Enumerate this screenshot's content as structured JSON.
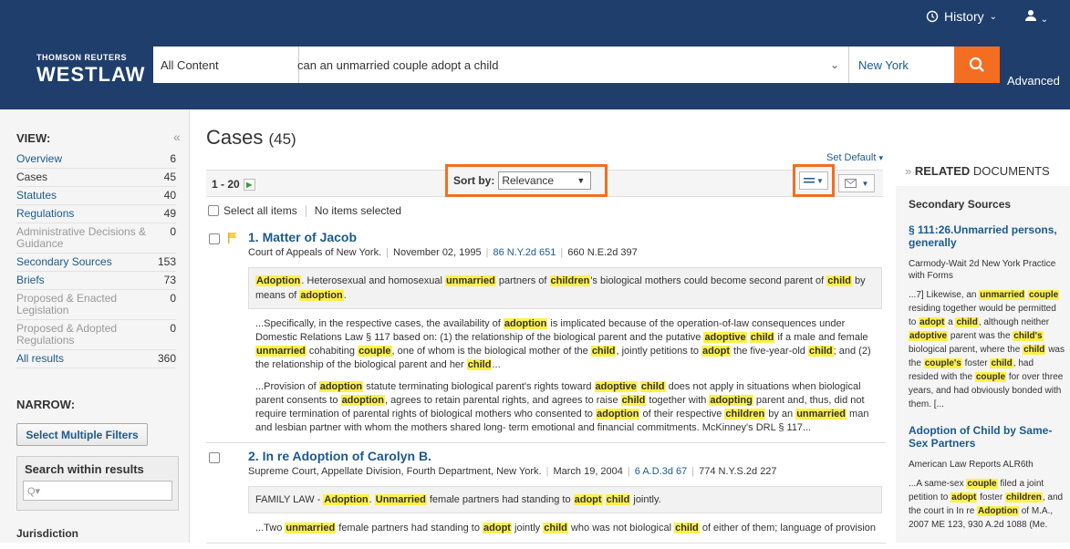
{
  "topbar": {
    "history": "History",
    "user_chevron": "⌄"
  },
  "logo": {
    "line1": "THOMSON REUTERS",
    "line2": "WESTLAW"
  },
  "search": {
    "scope": "All Content",
    "query": "can an unmarried couple adopt a child",
    "jurisdiction": "New York",
    "advanced": "Advanced"
  },
  "sidebar": {
    "view_label": "VIEW:",
    "items": [
      {
        "label": "Overview",
        "count": "6",
        "state": "link"
      },
      {
        "label": "Cases",
        "count": "45",
        "state": "active"
      },
      {
        "label": "Statutes",
        "count": "40",
        "state": "link"
      },
      {
        "label": "Regulations",
        "count": "49",
        "state": "link"
      },
      {
        "label": "Administrative Decisions & Guidance",
        "count": "0",
        "state": "disabled"
      },
      {
        "label": "Secondary Sources",
        "count": "153",
        "state": "link"
      },
      {
        "label": "Briefs",
        "count": "73",
        "state": "link"
      },
      {
        "label": "Proposed & Enacted Legislation",
        "count": "0",
        "state": "disabled"
      },
      {
        "label": "Proposed & Adopted Regulations",
        "count": "0",
        "state": "disabled"
      },
      {
        "label": "All results",
        "count": "360",
        "state": "link"
      }
    ],
    "narrow_label": "NARROW:",
    "filter_button": "Select Multiple Filters",
    "search_within": "Search within results",
    "search_within_placeholder": "Q▾",
    "jurisdiction_label": "Jurisdiction"
  },
  "main": {
    "title": "Cases",
    "count": "(45)",
    "set_default": "Set Default",
    "pager": "1 - 20",
    "sort_label": "Sort by:",
    "sort_value": "Relevance",
    "select_all": "Select all items",
    "no_selected": "No items selected",
    "results": [
      {
        "num": "1.",
        "title": "Matter of Jacob",
        "court": "Court of Appeals of New York.",
        "date": "November 02, 1995",
        "cite1": "86 N.Y.2d 651",
        "cite2": "660 N.E.2d 397",
        "headnote": [
          [
            "Adoption",
            1
          ],
          [
            ". Heterosexual and homosexual ",
            0
          ],
          [
            "unmarried",
            1
          ],
          [
            " partners of ",
            0
          ],
          [
            "children",
            1
          ],
          [
            "'s biological mothers could become second parent of ",
            0
          ],
          [
            "child",
            1
          ],
          [
            " by means of ",
            0
          ],
          [
            "adoption",
            1
          ],
          [
            ".",
            0
          ]
        ],
        "snippets": [
          [
            [
              "...Specifically, in the respective cases, the availability of ",
              0
            ],
            [
              "adoption",
              1
            ],
            [
              " is implicated because of the operation-of-law consequences under Domestic Relations Law §  117 based on:  (1) the relationship of the biological parent and the putative ",
              0
            ],
            [
              "adoptive",
              1
            ],
            [
              " ",
              0
            ],
            [
              "child",
              1
            ],
            [
              " if a male and female ",
              0
            ],
            [
              "unmarried",
              1
            ],
            [
              " cohabiting ",
              0
            ],
            [
              "couple",
              1
            ],
            [
              ", one of whom is the biological mother of the ",
              0
            ],
            [
              "child",
              1
            ],
            [
              ", jointly petitions to ",
              0
            ],
            [
              "adopt",
              1
            ],
            [
              " the five-year-old ",
              0
            ],
            [
              "child",
              1
            ],
            [
              ";  and (2) the relationship of the biological parent and her ",
              0
            ],
            [
              "child",
              1
            ],
            [
              "...",
              0
            ]
          ],
          [
            [
              "...Provision of ",
              0
            ],
            [
              "adoption",
              1
            ],
            [
              " statute terminating biological parent's rights toward ",
              0
            ],
            [
              "adoptive",
              1
            ],
            [
              " ",
              0
            ],
            [
              "child",
              1
            ],
            [
              " does not apply in situations when biological parent consents to ",
              0
            ],
            [
              "adoption",
              1
            ],
            [
              ", agrees to retain parental rights, and agrees to raise ",
              0
            ],
            [
              "child",
              1
            ],
            [
              " together with ",
              0
            ],
            [
              "adopting",
              1
            ],
            [
              " parent and, thus, did not require termination of parental rights of biological mothers who consented to ",
              0
            ],
            [
              "adoption",
              1
            ],
            [
              " of their respective ",
              0
            ],
            [
              "children",
              1
            ],
            [
              " by an ",
              0
            ],
            [
              "unmarried",
              1
            ],
            [
              " man and lesbian partner with whom the mothers shared long- term emotional and financial commitments.   McKinney's DRL §  117...",
              0
            ]
          ]
        ]
      },
      {
        "num": "2.",
        "title": "In re Adoption of Carolyn B.",
        "court": "Supreme Court, Appellate Division, Fourth Department, New York.",
        "date": "March 19, 2004",
        "cite1": "6 A.D.3d 67",
        "cite2": "774 N.Y.S.2d 227",
        "headnote": [
          [
            "FAMILY LAW - ",
            0
          ],
          [
            "Adoption",
            1
          ],
          [
            ". ",
            0
          ],
          [
            "Unmarried",
            1
          ],
          [
            " female partners had standing to ",
            0
          ],
          [
            "adopt",
            1
          ],
          [
            " ",
            0
          ],
          [
            "child",
            1
          ],
          [
            " jointly.",
            0
          ]
        ],
        "snippets": [
          [
            [
              "...Two ",
              0
            ],
            [
              "unmarried",
              1
            ],
            [
              " female partners had standing to ",
              0
            ],
            [
              "adopt",
              1
            ],
            [
              " jointly ",
              0
            ],
            [
              "child",
              1
            ],
            [
              " who was not biological ",
              0
            ],
            [
              "child",
              1
            ],
            [
              " of either of them; language of provision",
              0
            ]
          ]
        ]
      }
    ]
  },
  "related": {
    "heading_prefix": "RELATED",
    "heading_rest": "DOCUMENTS",
    "section": "Secondary Sources",
    "docs": [
      {
        "title": "§ 111:26.Unmarried persons, generally",
        "source": "Carmody-Wait 2d New York Practice with Forms",
        "snippet": [
          [
            "...7] Likewise, an ",
            0
          ],
          [
            "unmarried",
            1
          ],
          [
            " ",
            0
          ],
          [
            "couple",
            1
          ],
          [
            " residing together would be permitted to ",
            0
          ],
          [
            "adopt",
            1
          ],
          [
            " a ",
            0
          ],
          [
            "child",
            1
          ],
          [
            ", although neither ",
            0
          ],
          [
            "adoptive",
            1
          ],
          [
            " parent was the ",
            0
          ],
          [
            "child's",
            1
          ],
          [
            " biological parent, where the ",
            0
          ],
          [
            "child",
            1
          ],
          [
            " was the ",
            0
          ],
          [
            "couple's",
            1
          ],
          [
            " foster ",
            0
          ],
          [
            "child",
            1
          ],
          [
            ", had resided with the ",
            0
          ],
          [
            "couple",
            1
          ],
          [
            " for over three years, and had obviously bonded with them. [...",
            0
          ]
        ]
      },
      {
        "title": "Adoption of Child by Same-Sex Partners",
        "source": "American Law Reports ALR6th",
        "snippet": [
          [
            "...A same-sex ",
            0
          ],
          [
            "couple",
            1
          ],
          [
            " filed a joint petition to ",
            0
          ],
          [
            "adopt",
            1
          ],
          [
            " foster ",
            0
          ],
          [
            "children",
            1
          ],
          [
            ", and the court in In re ",
            0
          ],
          [
            "Adoption",
            1
          ],
          [
            " of M.A., 2007 ME 123, 930 A.2d 1088 (Me.",
            0
          ]
        ]
      }
    ]
  },
  "colors": {
    "navy": "#1f3e6b",
    "accent": "#f36e21",
    "link": "#1c5a8d",
    "highlight": "#fff04a"
  }
}
